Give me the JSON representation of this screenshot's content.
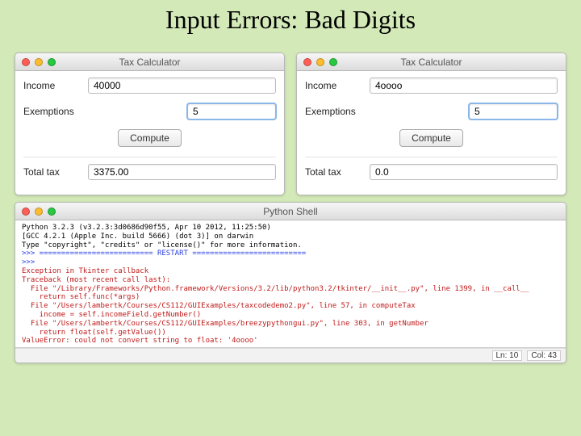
{
  "slide": {
    "title": "Input Errors: Bad Digits"
  },
  "app_left": {
    "window_title": "Tax Calculator",
    "income_label": "Income",
    "income_value": "40000",
    "exemptions_label": "Exemptions",
    "exemptions_value": "5",
    "compute_label": "Compute",
    "total_label": "Total tax",
    "total_value": "3375.00"
  },
  "app_right": {
    "window_title": "Tax Calculator",
    "income_label": "Income",
    "income_value": "4oooo",
    "exemptions_label": "Exemptions",
    "exemptions_value": "5",
    "compute_label": "Compute",
    "total_label": "Total tax",
    "total_value": "0.0"
  },
  "shell": {
    "window_title": "Python Shell",
    "lines": {
      "l0": "Python 3.2.3 (v3.2.3:3d0686d90f55, Apr 10 2012, 11:25:50)",
      "l1": "[GCC 4.2.1 (Apple Inc. build 5666) (dot 3)] on darwin",
      "l2": "Type \"copyright\", \"credits\" or \"license()\" for more information.",
      "l3": ">>> ========================== RESTART ==========================",
      "l4": ">>>",
      "l5": "Exception in Tkinter callback",
      "l6": "Traceback (most recent call last):",
      "l7": "  File \"/Library/Frameworks/Python.framework/Versions/3.2/lib/python3.2/tkinter/__init__.py\", line 1399, in __call__",
      "l8": "    return self.func(*args)",
      "l9": "  File \"/Users/lambertk/Courses/CS112/GUIExamples/taxcodedemo2.py\", line 57, in computeTax",
      "l10": "    income = self.incomeField.getNumber()",
      "l11": "  File \"/Users/lambertk/Courses/CS112/GUIExamples/breezypythongui.py\", line 303, in getNumber",
      "l12": "    return float(self.getValue())",
      "l13": "ValueError: could not convert string to float: '4oooo'"
    },
    "status": {
      "ln": "Ln: 10",
      "col": "Col: 43"
    }
  }
}
